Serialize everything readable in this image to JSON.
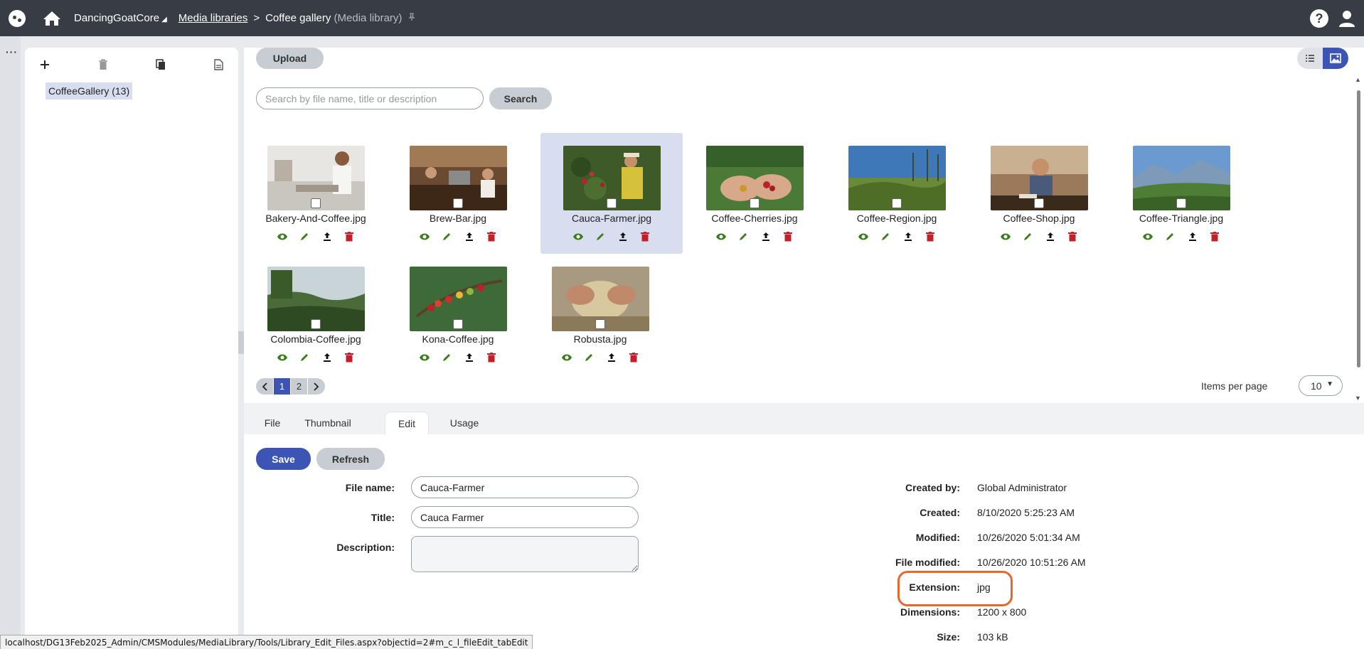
{
  "topbar": {
    "site_name": "DancingGoatCore",
    "site_caret": "◢",
    "breadcrumb_link": "Media libraries",
    "breadcrumb_sep": ">",
    "breadcrumb_current": "Coffee gallery",
    "breadcrumb_sub": "(Media library)",
    "help": "?"
  },
  "rail": {
    "menu": "···"
  },
  "tree": {
    "node_label": "CoffeeGallery (13)"
  },
  "toolbar": {
    "upload_label": "Upload",
    "search_placeholder": "Search by file name, title or description",
    "search_label": "Search"
  },
  "files": [
    {
      "name": "Bakery-And-Coffee.jpg",
      "selected": false
    },
    {
      "name": "Brew-Bar.jpg",
      "selected": false
    },
    {
      "name": "Cauca-Farmer.jpg",
      "selected": true
    },
    {
      "name": "Coffee-Cherries.jpg",
      "selected": false
    },
    {
      "name": "Coffee-Region.jpg",
      "selected": false
    },
    {
      "name": "Coffee-Shop.jpg",
      "selected": false
    },
    {
      "name": "Coffee-Triangle.jpg",
      "selected": false
    },
    {
      "name": "Colombia-Coffee.jpg",
      "selected": false
    },
    {
      "name": "Kona-Coffee.jpg",
      "selected": false
    },
    {
      "name": "Robusta.jpg",
      "selected": false
    }
  ],
  "pager": {
    "pages": [
      "1",
      "2"
    ],
    "current": "1",
    "items_per_page_label": "Items per page",
    "items_per_page_value": "10"
  },
  "tabs": [
    {
      "label": "File",
      "active": false
    },
    {
      "label": "Thumbnail",
      "active": false
    },
    {
      "label": "Edit",
      "active": true
    },
    {
      "label": "Usage",
      "active": false
    }
  ],
  "edit_form": {
    "save_label": "Save",
    "refresh_label": "Refresh",
    "file_name_label": "File name:",
    "file_name_value": "Cauca-Farmer",
    "title_label": "Title:",
    "title_value": "Cauca Farmer",
    "description_label": "Description:",
    "description_value": ""
  },
  "info": {
    "created_by_label": "Created by:",
    "created_by_value": "Global Administrator",
    "created_label": "Created:",
    "created_value": "8/10/2020 5:25:23 AM",
    "modified_label": "Modified:",
    "modified_value": "10/26/2020 5:01:34 AM",
    "file_modified_label": "File modified:",
    "file_modified_value": "10/26/2020 10:51:26 AM",
    "extension_label": "Extension:",
    "extension_value": "jpg",
    "dimensions_label": "Dimensions:",
    "dimensions_value": "1200 x 800",
    "size_label": "Size:",
    "size_value": "103 kB"
  },
  "statusbar": {
    "url": "localhost/DG13Feb2025_Admin/CMSModules/MediaLibrary/Tools/Library_Edit_Files.aspx?objectid=2#m_c_l_fileEdit_tabEdit"
  },
  "colors": {
    "accent": "#3c55b5",
    "topbar": "#383c44",
    "view_icon": "#3a7d1a",
    "edit_icon": "#3a7d1a",
    "delete_icon": "#c0202a",
    "highlight": "#e8672e"
  }
}
